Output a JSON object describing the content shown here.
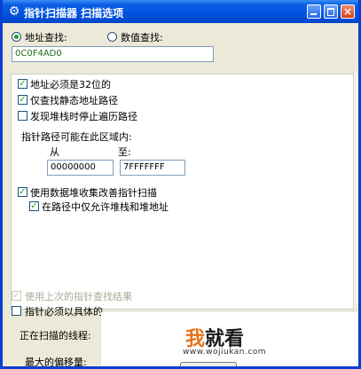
{
  "window": {
    "title": "指针扫描器 扫描选项",
    "app_icon": "gear-icon",
    "close_glyph": "×"
  },
  "search_mode": {
    "address_label": "地址查找:",
    "value_label": "数值查找:",
    "selected": "address",
    "address_value": "0C0F4AD0"
  },
  "options": {
    "must_32bit": {
      "label": "地址必须是32位的",
      "checked": true
    },
    "only_static": {
      "label": "仅查找静态地址路径",
      "checked": true
    },
    "stop_on_stack": {
      "label": "发现堆栈时停止遍历路径",
      "checked": false
    },
    "region_label": "指针路径可能在此区域内:",
    "from_label": "从",
    "to_label": "至:",
    "from_value": "00000000",
    "to_value": "7FFFFFFF",
    "use_heap": {
      "label": "使用数据堆收集改善指针扫描",
      "checked": true
    },
    "only_heap_stack": {
      "label": "在路径中仅允许堆栈和堆地址",
      "checked": true
    }
  },
  "bottom": {
    "use_last_result": {
      "label": "使用上次的指针查找结果",
      "checked": true,
      "disabled": true
    },
    "must_specific": {
      "label": "指针必须以具体的",
      "checked": false
    },
    "threads_label": "正在扫描的线程:",
    "max_offset_label": "最大的偏移量:"
  },
  "watermark": {
    "first_char": "我",
    "rest": "就看",
    "url": "www.wojiukan.com"
  }
}
